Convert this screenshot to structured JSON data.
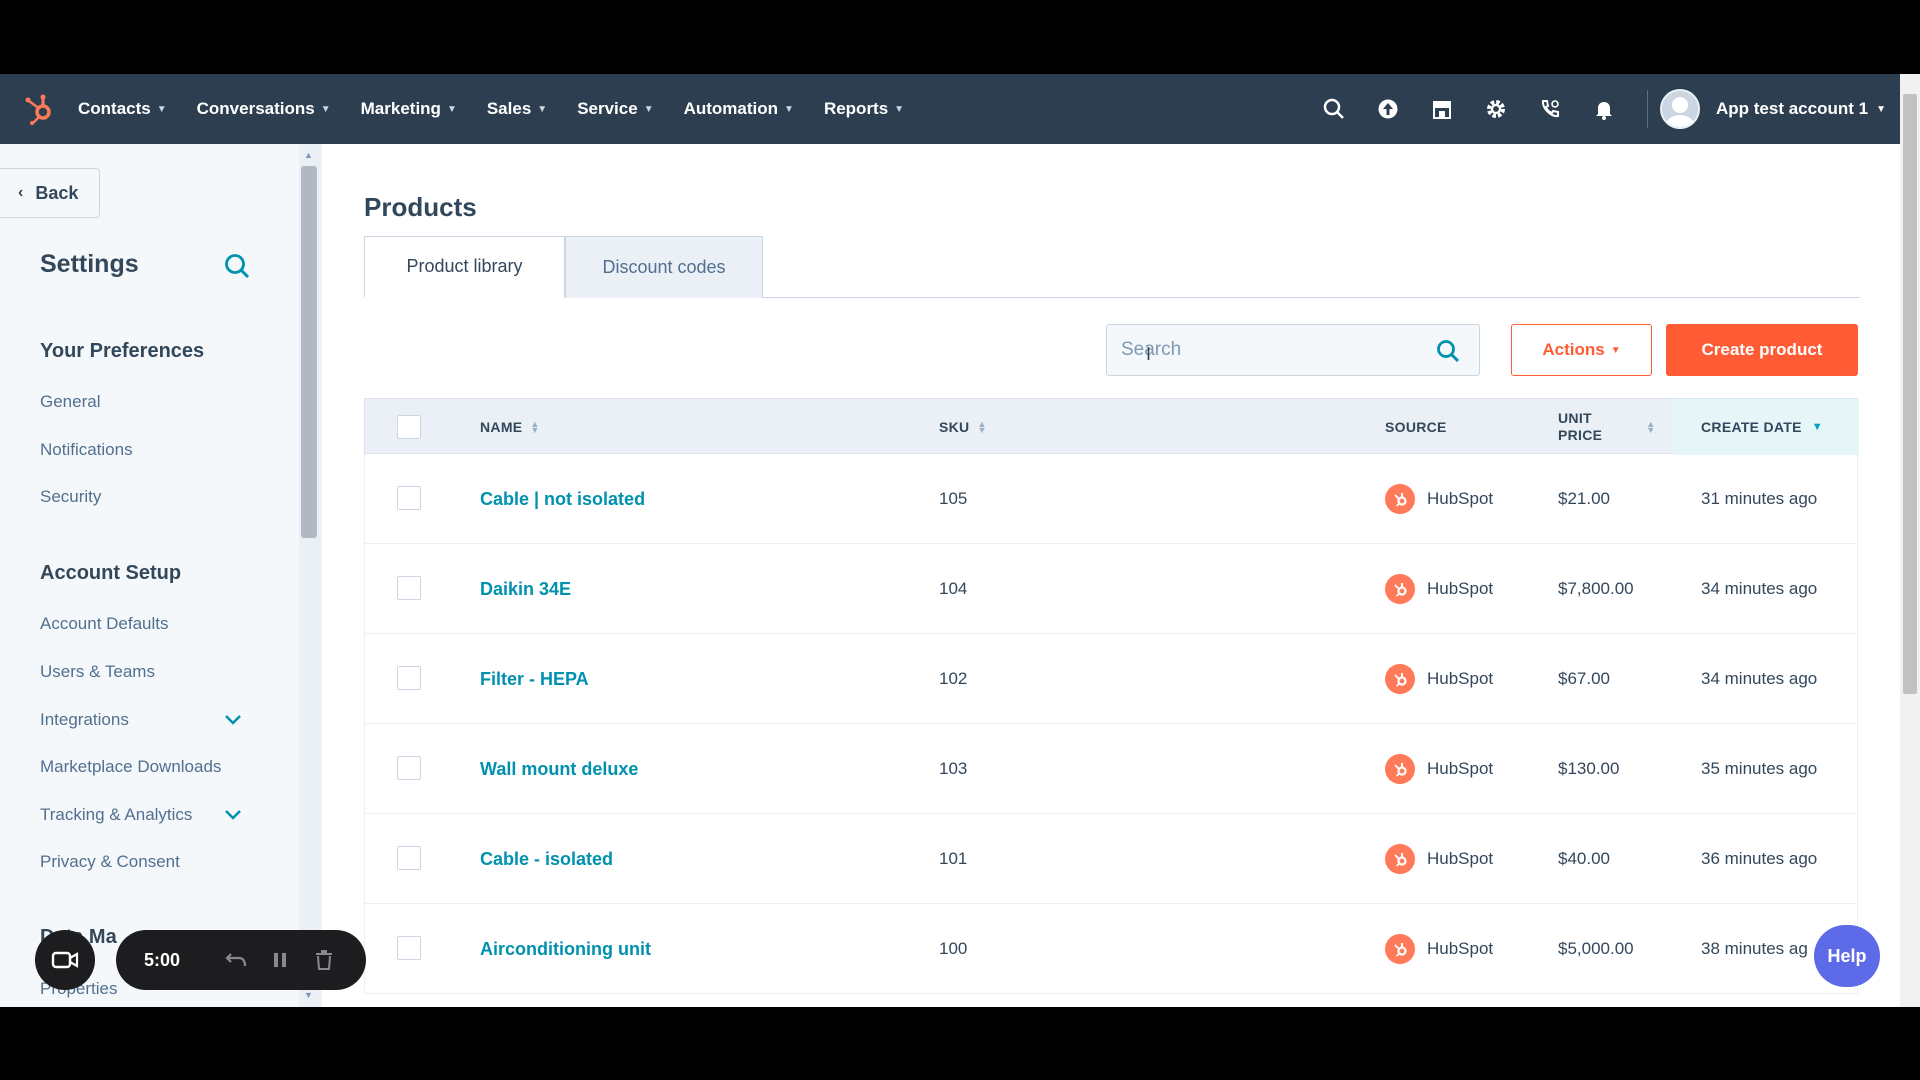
{
  "topnav": {
    "items": [
      {
        "label": "Contacts"
      },
      {
        "label": "Conversations"
      },
      {
        "label": "Marketing"
      },
      {
        "label": "Sales"
      },
      {
        "label": "Service"
      },
      {
        "label": "Automation"
      },
      {
        "label": "Reports"
      }
    ],
    "account_name": "App test account 1"
  },
  "sidebar": {
    "back_label": "Back",
    "title": "Settings",
    "sections": {
      "preferences": "Your Preferences",
      "account_setup": "Account Setup",
      "partial": "Data Ma"
    },
    "preferences_items": [
      "General",
      "Notifications",
      "Security"
    ],
    "account_items": [
      "Account Defaults",
      "Users & Teams",
      "Integrations",
      "Marketplace Downloads",
      "Tracking & Analytics",
      "Privacy & Consent"
    ],
    "partial_item": "Properties"
  },
  "main": {
    "title": "Products",
    "tabs": [
      "Product library",
      "Discount codes"
    ],
    "search_placeholder": "Search",
    "actions_label": "Actions",
    "create_label": "Create product"
  },
  "table": {
    "headers": {
      "name": "NAME",
      "sku": "SKU",
      "source": "SOURCE",
      "unit_price_1": "UNIT",
      "unit_price_2": "PRICE",
      "create_date": "CREATE DATE"
    },
    "rows": [
      {
        "name": "Cable | not isolated",
        "sku": "105",
        "source": "HubSpot",
        "price": "$21.00",
        "date": "31 minutes ago"
      },
      {
        "name": "Daikin 34E",
        "sku": "104",
        "source": "HubSpot",
        "price": "$7,800.00",
        "date": "34 minutes ago"
      },
      {
        "name": "Filter - HEPA",
        "sku": "102",
        "source": "HubSpot",
        "price": "$67.00",
        "date": "34 minutes ago"
      },
      {
        "name": "Wall mount deluxe",
        "sku": "103",
        "source": "HubSpot",
        "price": "$130.00",
        "date": "35 minutes ago"
      },
      {
        "name": "Cable - isolated",
        "sku": "101",
        "source": "HubSpot",
        "price": "$40.00",
        "date": "36 minutes ago"
      },
      {
        "name": "Airconditioning unit",
        "sku": "100",
        "source": "HubSpot",
        "price": "$5,000.00",
        "date": "38 minutes ag"
      }
    ]
  },
  "recorder": {
    "time": "5:00"
  },
  "help_label": "Help",
  "colors": {
    "accent": "#ff5c35",
    "nav_bg": "#2d3e50",
    "link": "#0091ae",
    "help": "#5e6be8"
  },
  "icons": [
    "hubspot-logo-icon",
    "search-icon",
    "upgrade-icon",
    "marketplace-icon",
    "settings-gear-icon",
    "calling-icon",
    "notification-bell-icon",
    "chevron-down-icon",
    "camera-icon",
    "undo-icon",
    "pause-icon",
    "trash-icon"
  ]
}
